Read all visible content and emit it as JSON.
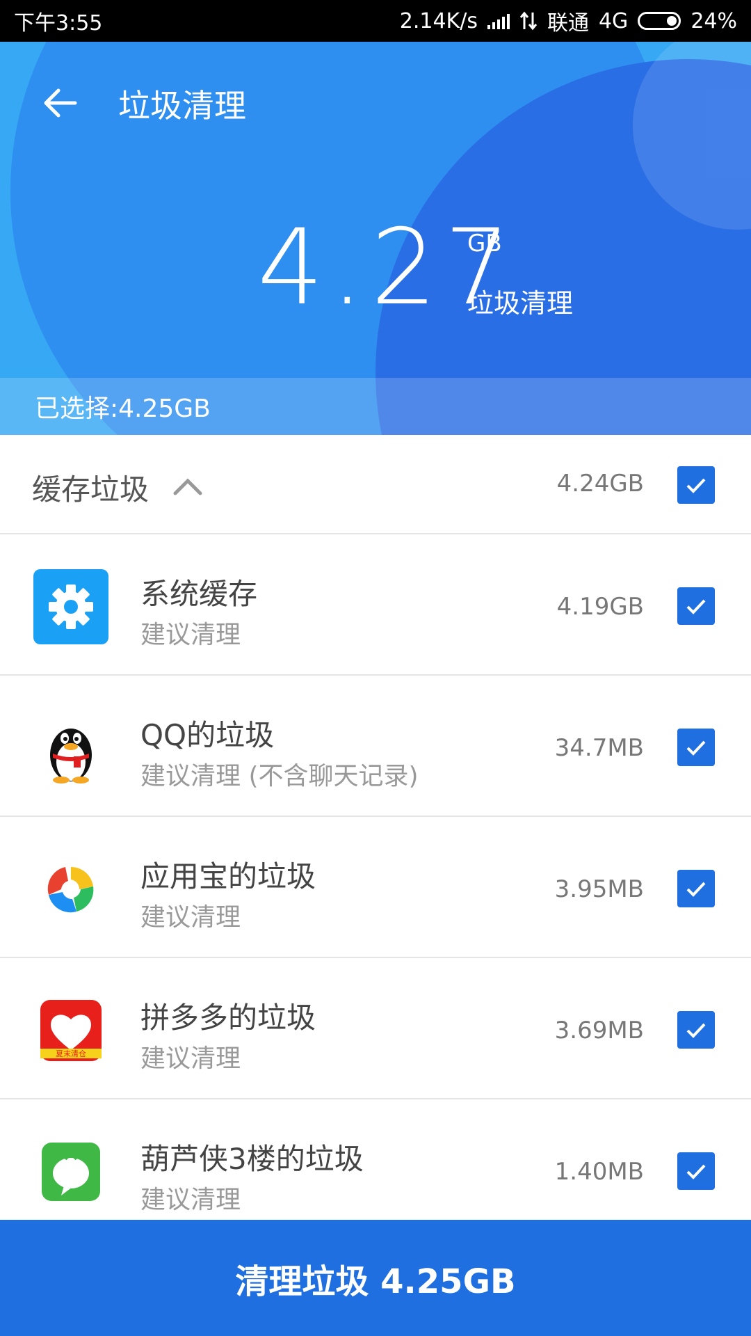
{
  "status_bar": {
    "time": "下午3:55",
    "net_speed": "2.14K/s",
    "carrier": "联通",
    "network": "4G",
    "battery": "24%"
  },
  "header": {
    "title": "垃圾清理",
    "total_value": "4.27",
    "total_unit": "GB",
    "total_label": "垃圾清理",
    "selected": "已选择:4.25GB"
  },
  "section": {
    "label": "缓存垃圾",
    "size": "4.24GB",
    "checked": true
  },
  "items": [
    {
      "title": "系统缓存",
      "subtitle": "建议清理",
      "size": "4.19GB",
      "icon": "settings-gear-icon",
      "checked": true
    },
    {
      "title": "QQ的垃圾",
      "subtitle": "建议清理 (不含聊天记录)",
      "size": "34.7MB",
      "icon": "qq-penguin-icon",
      "checked": true
    },
    {
      "title": "应用宝的垃圾",
      "subtitle": "建议清理",
      "size": "3.95MB",
      "icon": "yingyongbao-icon",
      "checked": true
    },
    {
      "title": "拼多多的垃圾",
      "subtitle": "建议清理",
      "size": "3.69MB",
      "icon": "pinduoduo-icon",
      "icon_text": "夏末清仓",
      "checked": true
    },
    {
      "title": "葫芦侠3楼的垃圾",
      "subtitle": "建议清理",
      "size": "1.40MB",
      "icon": "huluxia-icon",
      "checked": true
    }
  ],
  "clean_button": "清理垃圾 4.25GB",
  "colors": {
    "header_light": "#36a8f4",
    "header_mid": "#2f8ff0",
    "header_dark": "#2a6ee6",
    "accent": "#1f6fe0"
  }
}
